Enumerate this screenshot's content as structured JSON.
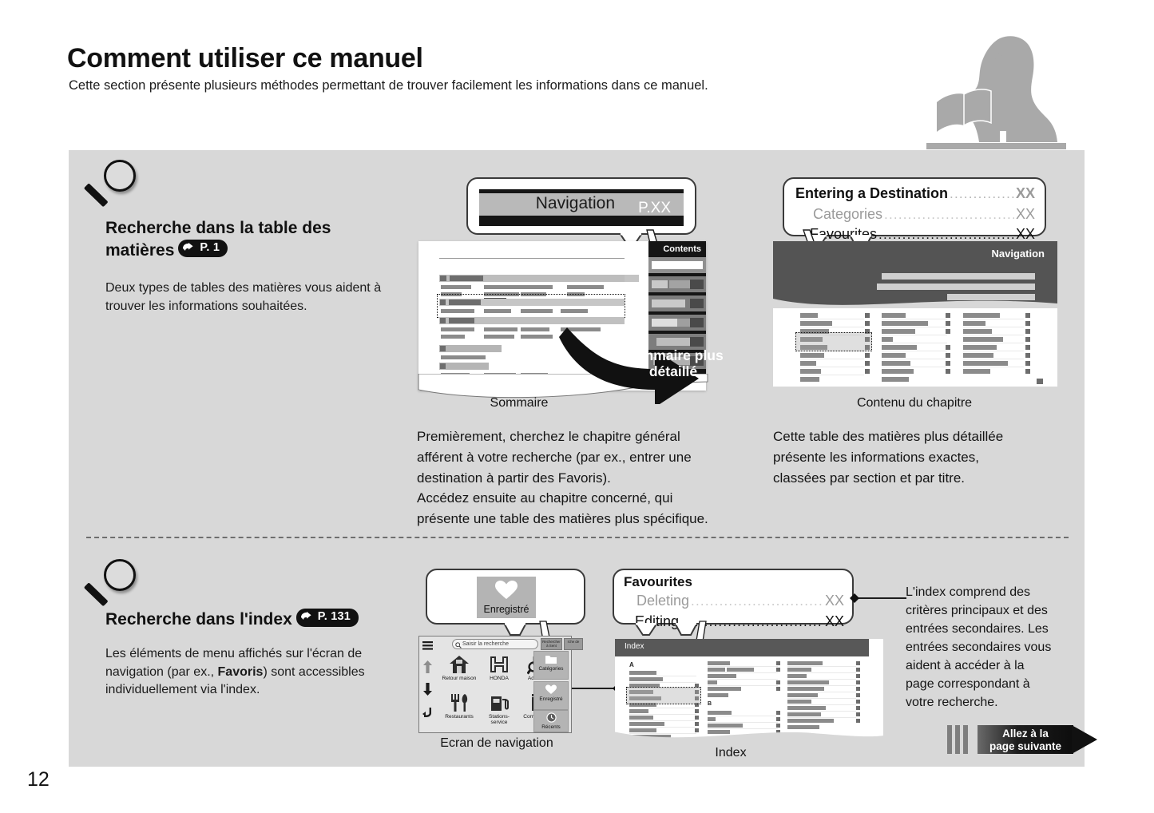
{
  "page": {
    "title": "Comment utiliser ce manuel",
    "subtitle": "Cette section présente plusieurs méthodes permettant de trouver facilement les informations dans ce manuel.",
    "folio": "12",
    "reader_icon": "person-reading-book-icon"
  },
  "section_toc": {
    "magnifier_icon": "magnifier-icon",
    "heading": "Recherche dans la table des matières",
    "page_ref": "P. 1",
    "body": "Deux types de tables des matières vous aident à trouver les informations souhaitées.",
    "nav_callout": {
      "label": "Navigation",
      "page": "P.XX"
    },
    "chapter_callout": {
      "lines": [
        {
          "label": "Entering a Destination",
          "page": "XX",
          "style": "main"
        },
        {
          "label": "Categories",
          "page": "XX",
          "style": "muted"
        },
        {
          "label": "Favourites",
          "page": "XX",
          "style": "plain"
        }
      ]
    },
    "left_mock": {
      "tab_label": "Contents",
      "caption": "Sommaire"
    },
    "right_mock": {
      "header_label": "Navigation",
      "caption": "Contenu du chapitre"
    },
    "arrow_label": "Sommaire plus détaillé",
    "left_text": "Premièrement, cherchez le chapitre général afférent à votre recherche (par ex., entrer une destination à partir des Favoris).\nAccédez ensuite au chapitre concerné, qui présente une table des matières plus spécifique.",
    "left_text_lines": [
      "Premièrement, cherchez le chapitre général",
      "afférent à votre recherche (par ex., entrer une",
      "destination à partir des Favoris).",
      "Accédez ensuite au chapitre concerné, qui",
      "présente une table des matières plus spécifique."
    ],
    "right_text_lines": [
      "Cette table des matières plus détaillée",
      "présente les informations exactes,",
      "classées par section et par titre."
    ]
  },
  "section_index": {
    "magnifier_icon": "magnifier-icon",
    "heading": "Recherche dans l'index",
    "page_ref": "P. 131",
    "body_prefix": "Les éléments de menu affichés sur l'écran de navigation (par ex., ",
    "body_bold": "Favoris",
    "body_suffix": ") sont accessibles individuellement via l'index.",
    "saved_callout": {
      "icon": "heart-icon",
      "label": "Enregistré"
    },
    "favourites_callout": {
      "title": "Favourites",
      "lines": [
        {
          "label": "Deleting",
          "page": "XX",
          "style": "muted"
        },
        {
          "label": "Editing",
          "page": "XX",
          "style": "plain"
        }
      ]
    },
    "nav_screen": {
      "caption": "Ecran de navigation",
      "search_placeholder": "Saisir la recherche",
      "search_icon": "search-icon",
      "menu_icon": "hamburger-menu-icon",
      "up_icon": "arrow-up-icon",
      "down_icon": "arrow-down-icon",
      "back_icon": "back-arrow-icon",
      "tabs": [
        {
          "label": "Rechercher à Sent"
        },
        {
          "label": "rche de"
        }
      ],
      "tiles": [
        {
          "label": "Retour maison",
          "icon": "home-icon"
        },
        {
          "label": "HONDA",
          "icon": "honda-logo-icon"
        },
        {
          "label": "Adresse",
          "icon": "address-search-icon"
        },
        {
          "label": "Restaurants",
          "icon": "cutlery-icon"
        },
        {
          "label": "Stations-service",
          "icon": "fuel-pump-icon"
        },
        {
          "label": "Commerces",
          "icon": "shopping-bag-icon"
        }
      ],
      "side_buttons": [
        {
          "label": "Catégories",
          "icon": "folder-icon"
        },
        {
          "label": "Enregistré",
          "icon": "heart-icon"
        },
        {
          "label": "Récents",
          "icon": "clock-icon"
        }
      ]
    },
    "index_mock": {
      "header_label": "Index",
      "caption": "Index",
      "section_letters": [
        "A",
        "B"
      ]
    },
    "note_lines": [
      "L'index comprend des",
      "critères principaux et des",
      "entrées secondaires. Les",
      "entrées secondaires vous",
      "aident à accéder à la",
      "page correspondant à",
      "votre recherche."
    ]
  },
  "next_page": {
    "line1": "Allez à la",
    "line2": "page suivante",
    "arrow_icon": "right-triangle-arrow-icon"
  },
  "colors": {
    "panel": "#d8d8d8",
    "dark": "#151515",
    "muted_text": "#9b9b9b"
  }
}
